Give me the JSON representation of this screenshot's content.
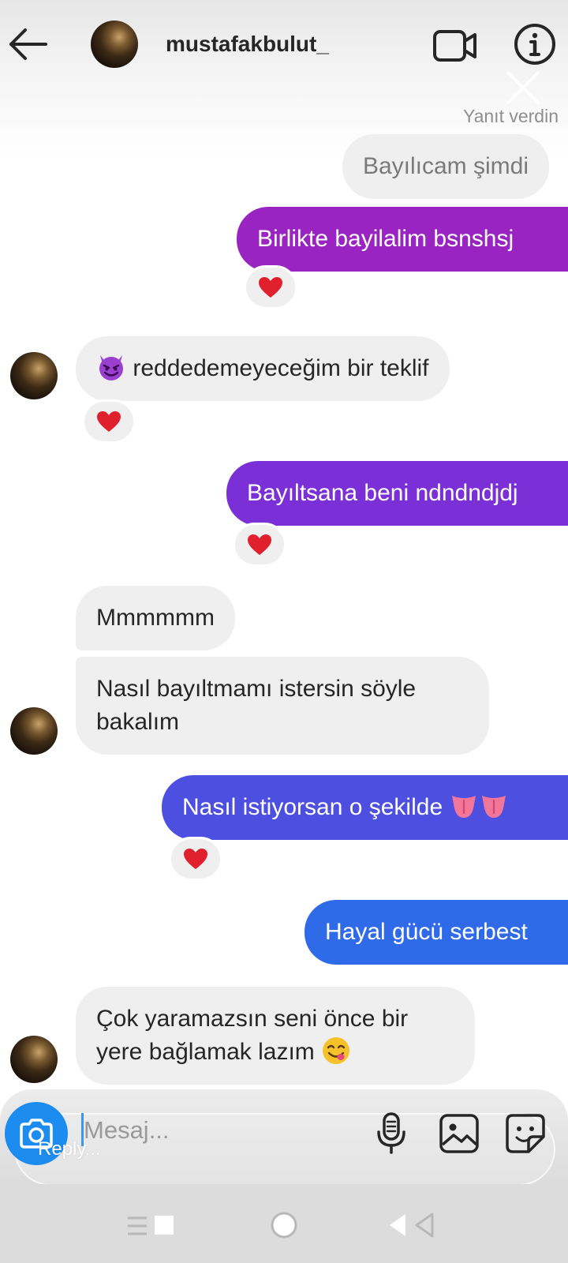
{
  "header": {
    "username": "mustafakbulut_",
    "reply_status": "Yanıt verdin"
  },
  "icons": {
    "back": "arrow-left-icon",
    "video": "video-camera-icon",
    "info": "info-icon",
    "close": "close-icon",
    "heart": "red-heart-emoji",
    "devil": "smiling-devil-emoji",
    "tongue": "tongue-emoji",
    "yum": "yum-face-emoji",
    "camera": "camera-icon",
    "mic": "microphone-icon",
    "gallery": "image-gallery-icon",
    "sticker": "sticker-icon"
  },
  "messages": [
    {
      "direction": "in",
      "text": "Bayılıcam şimdi",
      "replied": true
    },
    {
      "direction": "out",
      "text": "Birlikte bayilalim bsnshsj",
      "reaction": "heart"
    },
    {
      "direction": "in",
      "emoji": "devil",
      "text": "reddedemeyeceğim bir teklif",
      "reaction": "heart"
    },
    {
      "direction": "out",
      "text": "Bayıltsana beni ndndndjdj",
      "reaction": "heart"
    },
    {
      "direction": "in",
      "text": "Mmmmmm"
    },
    {
      "direction": "in",
      "text": "Nasıl bayıltmamı istersin söyle bakalım"
    },
    {
      "direction": "out",
      "text": "Nasıl istiyorsan o şekilde",
      "trailing_emoji": [
        "tongue",
        "tongue"
      ],
      "reaction": "heart"
    },
    {
      "direction": "out",
      "text": "Hayal gücü serbest"
    },
    {
      "direction": "in",
      "text": "Çok yaramazsın seni önce bir yere bağlamak lazım",
      "trailing_emoji": [
        "yum"
      ]
    }
  ],
  "composer": {
    "placeholder": "Mesaj...",
    "reply_label": "Reply..."
  },
  "colors": {
    "incoming_bubble": "#efefef",
    "outgoing_gradient": [
      "#9a24c2",
      "#7b2fd6",
      "#4d4fe0",
      "#2f6be8"
    ],
    "camera_button": "#1d8cf0"
  }
}
